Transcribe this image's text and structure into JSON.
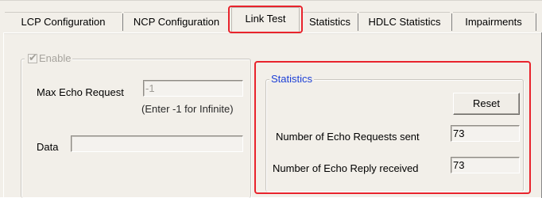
{
  "tabs": [
    {
      "label": "LCP Configuration",
      "active": false
    },
    {
      "label": "NCP Configuration",
      "active": false
    },
    {
      "label": "Link Test",
      "active": true
    },
    {
      "label": "Statistics",
      "active": false
    },
    {
      "label": "HDLC Statistics",
      "active": false
    },
    {
      "label": "Impairments",
      "active": false
    }
  ],
  "link_test": {
    "enable_label": "Enable",
    "enable_checked": true,
    "enable_disabled": true,
    "max_echo_label": "Max Echo Request",
    "max_echo_value": "-1",
    "max_echo_hint": "(Enter -1 for Infinite)",
    "data_label": "Data",
    "data_value": ""
  },
  "statistics": {
    "title": "Statistics",
    "reset_label": "Reset",
    "echo_sent_label": "Number of Echo Requests sent",
    "echo_sent_value": "73",
    "echo_reply_label": "Number of Echo Reply received",
    "echo_reply_value": "73"
  },
  "colors": {
    "highlight": "#e8232c",
    "group_title": "#1c3fd6",
    "dialog_bg": "#f2efe9"
  }
}
